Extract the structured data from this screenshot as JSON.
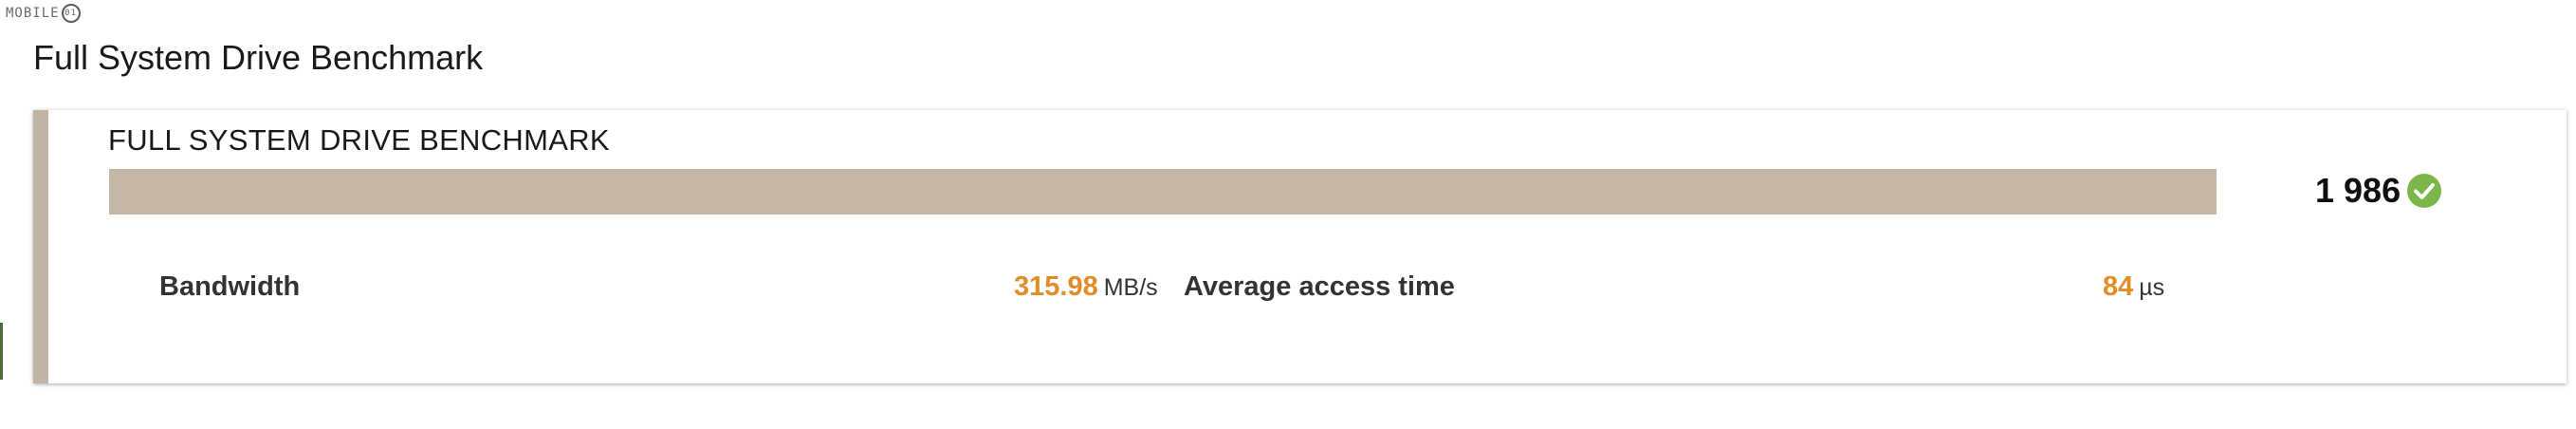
{
  "watermark": {
    "text": "MOBILE",
    "ring": "01"
  },
  "page": {
    "title": "Full System Drive Benchmark"
  },
  "card": {
    "title": "FULL SYSTEM DRIVE BENCHMARK",
    "progress_fraction": 1.0,
    "score": "1 986",
    "score_status_icon": "check-circle-icon",
    "metrics": [
      {
        "label": "Bandwidth",
        "value": "315.98",
        "unit": "MB/s"
      },
      {
        "label": "Average access time",
        "value": "84",
        "unit": "µs"
      }
    ]
  },
  "colors": {
    "accent_border": "#c1b4a6",
    "bar_fill": "#c4b7a8",
    "value_orange": "#e08d2a",
    "check_green": "#7ab648"
  }
}
